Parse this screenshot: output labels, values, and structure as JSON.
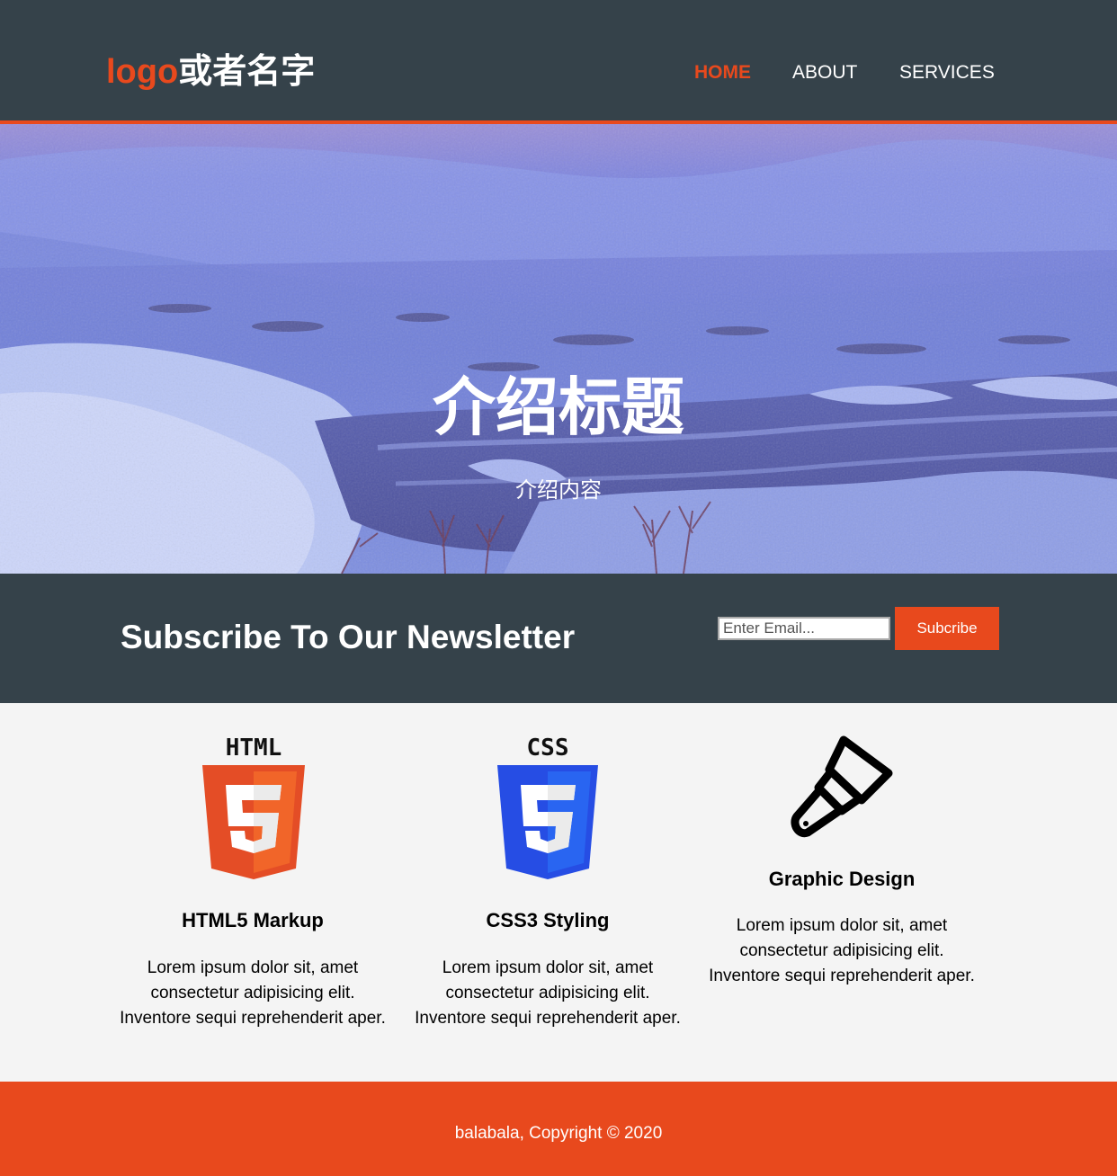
{
  "header": {
    "logo_highlight": "logo",
    "logo_rest": "或者名字",
    "nav": [
      {
        "label": "HOME"
      },
      {
        "label": "ABOUT"
      },
      {
        "label": "SERVICES"
      }
    ]
  },
  "hero": {
    "title": "介绍标题",
    "subtitle": "介绍内容"
  },
  "newsletter": {
    "title": "Subscribe To Our Newsletter",
    "email_placeholder": "Enter Email...",
    "button_label": "Subcribe"
  },
  "boxes": [
    {
      "icon": "html5-logo-icon",
      "icon_label": "HTML",
      "title": "HTML5 Markup",
      "text": [
        "Lorem ipsum dolor sit, amet",
        "consectetur adipisicing elit.",
        "Inventore sequi reprehenderit aper."
      ]
    },
    {
      "icon": "css3-logo-icon",
      "icon_label": "CSS",
      "title": "CSS3 Styling",
      "text": [
        "Lorem ipsum dolor sit, amet",
        "consectetur adipisicing elit.",
        "Inventore sequi reprehenderit aper."
      ]
    },
    {
      "icon": "brush-icon",
      "title": "Graphic Design",
      "text": [
        "Lorem ipsum dolor sit, amet",
        "consectetur adipisicing elit.",
        "Inventore sequi reprehenderit aper."
      ]
    }
  ],
  "footer": {
    "text": "balabala, Copyright © 2020"
  },
  "colors": {
    "dark": "#35424a",
    "accent": "#e8491d",
    "light_bg": "#f4f4f4",
    "html5": "#e44d26",
    "css3": "#264de4"
  }
}
